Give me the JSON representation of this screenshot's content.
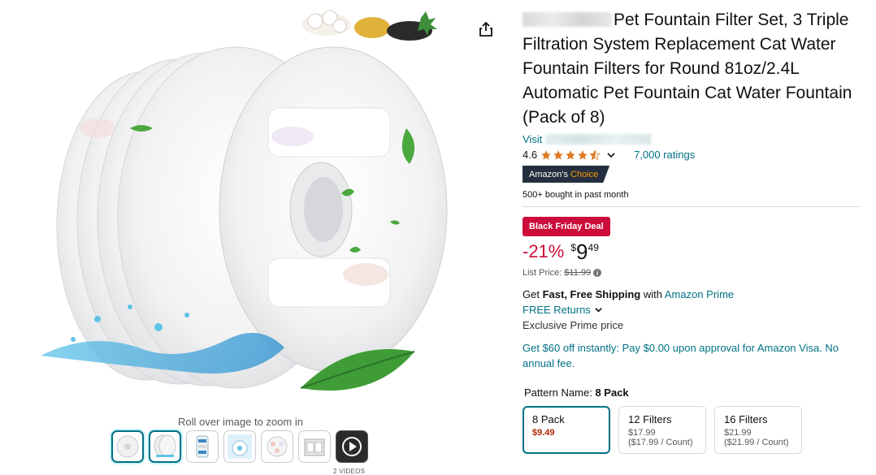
{
  "image": {
    "zoom_hint": "Roll over image to zoom in",
    "video_label": "2 VIDEOS",
    "thumbnails": [
      "filter-single",
      "filter-stack",
      "filter-diagram",
      "fountain-cat",
      "filter-layers",
      "product-box",
      "video"
    ]
  },
  "product": {
    "title": "Pet Fountain Filter Set, 3 Triple Filtration System Replacement Cat Water Fountain Filters for Round 81oz/2.4L Automatic Pet Fountain Cat Water Fountain (Pack of 8)",
    "store_prefix": "Visit",
    "rating": "4.6",
    "ratings_count": "7,000 ratings",
    "badge_prefix": "Amazon's",
    "badge_choice": "Choice",
    "bought": "500+ bought in past month"
  },
  "price": {
    "deal_badge": "Black Friday Deal",
    "discount": "-21%",
    "symbol": "$",
    "whole": "9",
    "fraction": "49",
    "list_label": "List Price:",
    "list_value": "$11.99"
  },
  "shipping": {
    "get": "Get",
    "fast": "Fast, Free Shipping",
    "with": "with",
    "prime": "Amazon Prime",
    "returns": "FREE Returns",
    "exclusive": "Exclusive Prime price"
  },
  "visa_offer": "Get $60 off instantly: Pay $0.00 upon approval for Amazon Visa. No annual fee.",
  "pattern": {
    "label": "Pattern Name:",
    "value": "8 Pack",
    "options": [
      {
        "label": "8 Pack",
        "price": "$9.49",
        "unit": ""
      },
      {
        "label": "12 Filters",
        "price": "$17.99",
        "unit": "($17.99 / Count)"
      },
      {
        "label": "16 Filters",
        "price": "$21.99",
        "unit": "($21.99 / Count)"
      }
    ]
  },
  "colors": {
    "link": "#007185",
    "deal": "#CC0C39",
    "badge_bg": "#232F3E",
    "choice": "#FF9900",
    "star": "#DE7921"
  }
}
